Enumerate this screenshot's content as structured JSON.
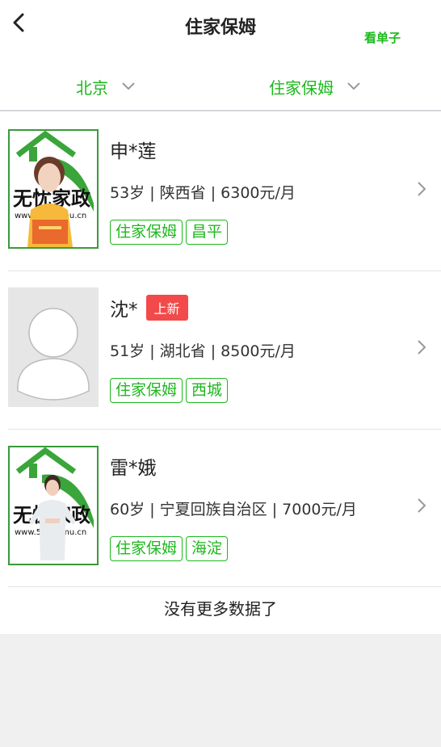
{
  "header": {
    "title": "住家保姆",
    "view_orders": "看单子"
  },
  "filters": {
    "city": "北京",
    "category": "住家保姆"
  },
  "logo_text": {
    "main": "无忧家政",
    "url": "www.51baomu.cn"
  },
  "items": [
    {
      "name": "申*莲",
      "badge": "",
      "info": "53岁 | 陕西省 | 6300元/月",
      "tags": [
        "住家保姆",
        "昌平"
      ],
      "avatar": "logo-photo"
    },
    {
      "name": "沈*",
      "badge": "上新",
      "info": "51岁 | 湖北省 | 8500元/月",
      "tags": [
        "住家保姆",
        "西城"
      ],
      "avatar": "placeholder"
    },
    {
      "name": "雷*娥",
      "badge": "",
      "info": "60岁 | 宁夏回族自治区 | 7000元/月",
      "tags": [
        "住家保姆",
        "海淀"
      ],
      "avatar": "logo-photo"
    }
  ],
  "footer": "没有更多数据了",
  "colors": {
    "accent": "#1db81d",
    "badge": "#f24a4a",
    "divider": "#e4e4e4",
    "background": "#f0f0f0"
  },
  "icons": [
    "back-arrow-icon",
    "chevron-down-icon",
    "chevron-right-icon"
  ]
}
